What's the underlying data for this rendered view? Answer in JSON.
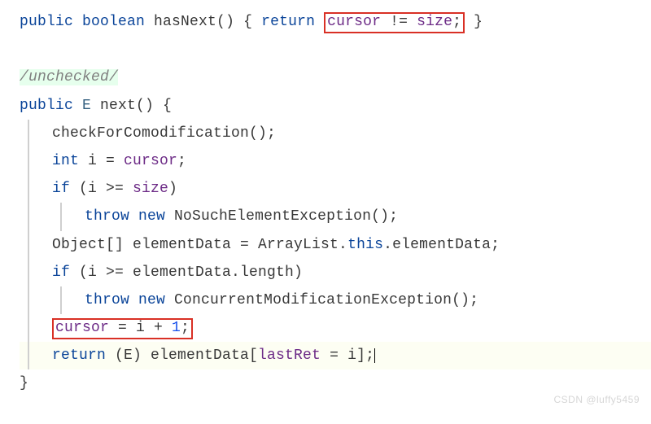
{
  "c": {
    "l1_public": "public",
    "l1_boolean": "boolean",
    "l1_fn": " hasNext() { ",
    "l1_return": "return",
    "l1_box_cursor": "cursor",
    "l1_box_op": " != ",
    "l1_box_size": "size",
    "l1_box_semi": ";",
    "l1_tail": " }",
    "annotation": "/unchecked/",
    "l3_public": "public",
    "l3_type": " E ",
    "l3_fn": "next() {",
    "l4": "checkForComodification();",
    "l5_int": "int",
    "l5_mid": " i = ",
    "l5_cursor": "cursor",
    "l5_semi": ";",
    "l6_if": "if",
    "l6_body": " (i >= ",
    "l6_size": "size",
    "l6_end": ")",
    "l7_throw": "throw",
    "l7_new": "new",
    "l7_ex": " NoSuchElementException();",
    "l8_a": "Object[] elementData = ArrayList.",
    "l8_this": "this",
    "l8_b": ".elementData;",
    "l9_if": "if",
    "l9_body": " (i >= elementData.length)",
    "l10_throw": "throw",
    "l10_new": "new",
    "l10_ex": " ConcurrentModificationException();",
    "l11_cursor": "cursor",
    "l11_mid": " = i + ",
    "l11_num": "1",
    "l11_semi": ";",
    "l12_return": "return",
    "l12_a": " (E) elementData[",
    "l12_lastRet": "lastRet",
    "l12_b": " = i];",
    "l13": "}"
  },
  "watermark": "CSDN @luffy5459"
}
